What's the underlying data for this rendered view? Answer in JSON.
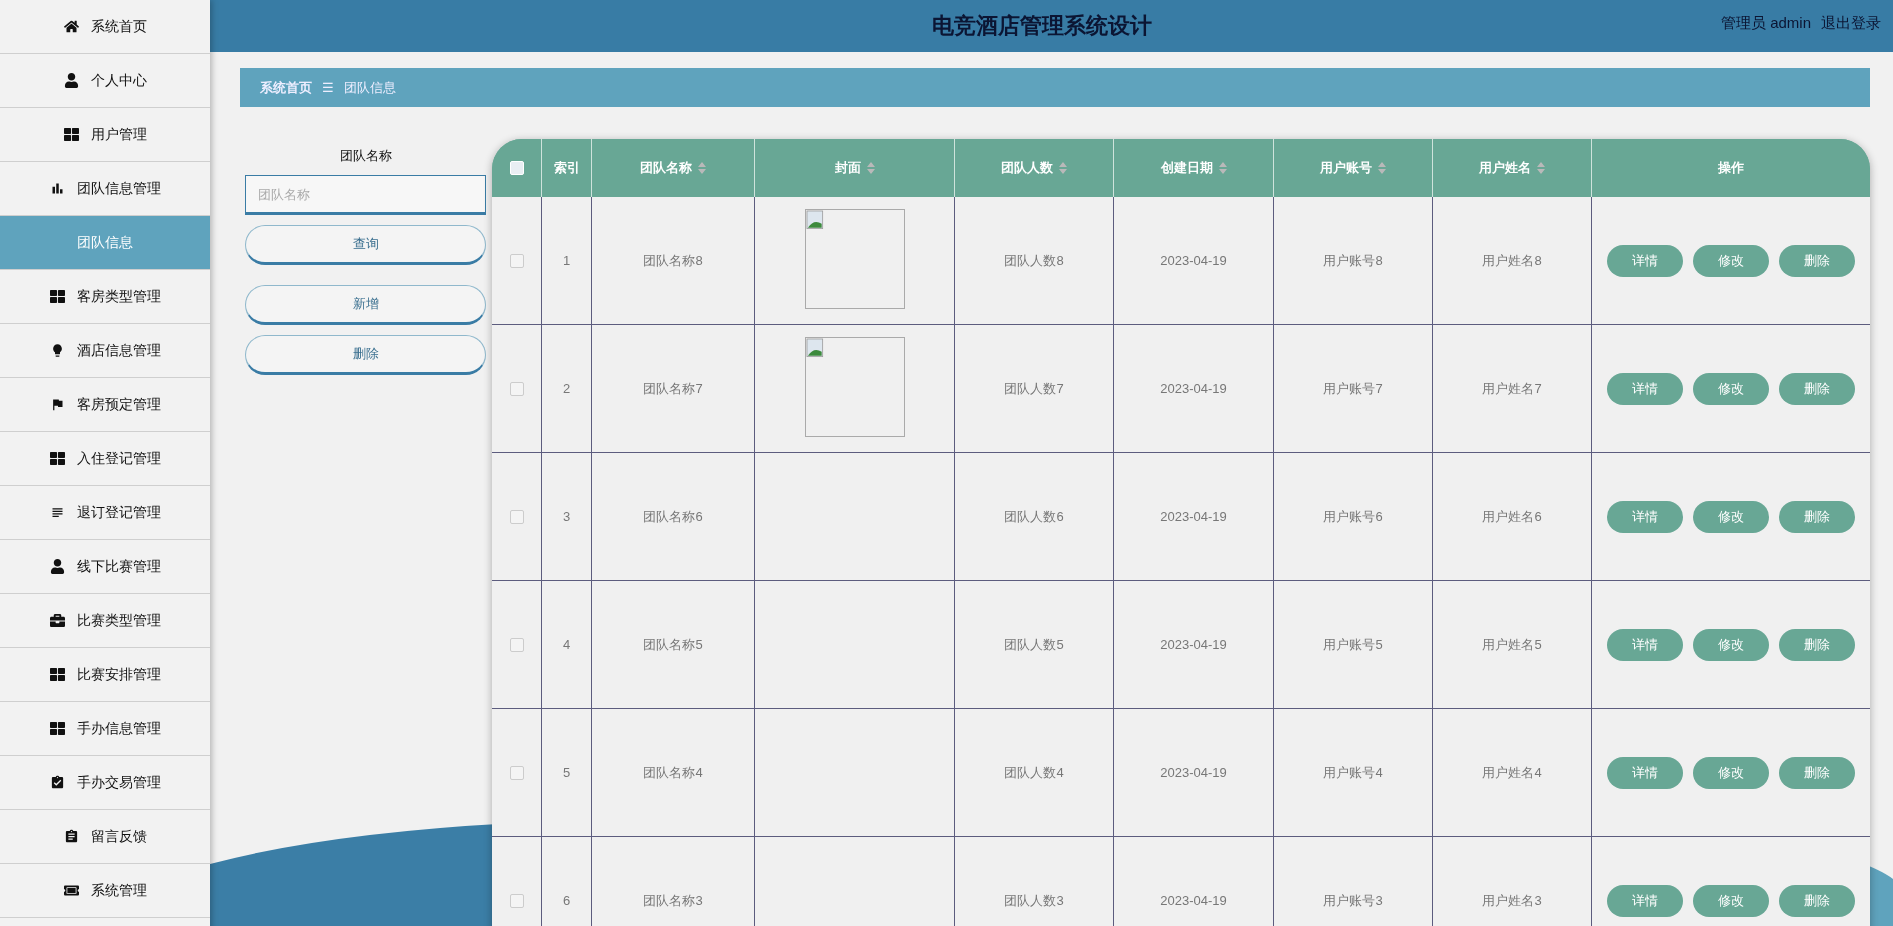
{
  "sidebar": {
    "items": [
      {
        "label": "系统首页",
        "selected": false
      },
      {
        "label": "个人中心",
        "selected": false
      },
      {
        "label": "用户管理",
        "selected": false
      },
      {
        "label": "团队信息管理",
        "selected": false,
        "expanded": true,
        "children": [
          {
            "label": "团队信息",
            "selected": true
          }
        ]
      },
      {
        "label": "客房类型管理",
        "selected": false
      },
      {
        "label": "酒店信息管理",
        "selected": false
      },
      {
        "label": "客房预定管理",
        "selected": false
      },
      {
        "label": "入住登记管理",
        "selected": false
      },
      {
        "label": "退订登记管理",
        "selected": false
      },
      {
        "label": "线下比赛管理",
        "selected": false
      },
      {
        "label": "比赛类型管理",
        "selected": false
      },
      {
        "label": "比赛安排管理",
        "selected": false
      },
      {
        "label": "手办信息管理",
        "selected": false
      },
      {
        "label": "手办交易管理",
        "selected": false
      },
      {
        "label": "留言反馈",
        "selected": false
      },
      {
        "label": "系统管理",
        "selected": false
      }
    ]
  },
  "header": {
    "title": "电竞酒店管理系统设计",
    "user": "管理员 admin",
    "logout": "退出登录"
  },
  "breadcrumb": {
    "home": "系统首页",
    "separator": "☰",
    "current": "团队信息"
  },
  "search": {
    "label": "团队名称",
    "placeholder": "团队名称",
    "buttons": [
      "查询",
      "新增",
      "删除"
    ]
  },
  "table": {
    "select_all": {
      "checked": false
    },
    "columns": [
      {
        "label": "索引",
        "sortable": false
      },
      {
        "label": "团队名称",
        "sortable": true
      },
      {
        "label": "封面",
        "sortable": true
      },
      {
        "label": "团队人数",
        "sortable": true
      },
      {
        "label": "创建日期",
        "sortable": true
      },
      {
        "label": "用户账号",
        "sortable": true
      },
      {
        "label": "用户姓名",
        "sortable": true
      },
      {
        "label": "操作",
        "sortable": false
      }
    ],
    "rows": [
      {
        "checked": false,
        "index": "1",
        "name": "团队名称8",
        "cover": true,
        "members": "团队人数8",
        "date": "2023-04-19",
        "account": "用户账号8",
        "username": "用户姓名8",
        "actions": [
          "详情",
          "修改",
          "删除"
        ]
      },
      {
        "checked": false,
        "index": "2",
        "name": "团队名称7",
        "cover": true,
        "members": "团队人数7",
        "date": "2023-04-19",
        "account": "用户账号7",
        "username": "用户姓名7",
        "actions": [
          "详情",
          "修改",
          "删除"
        ]
      },
      {
        "checked": false,
        "index": "3",
        "name": "团队名称6",
        "cover": false,
        "members": "团队人数6",
        "date": "2023-04-19",
        "account": "用户账号6",
        "username": "用户姓名6",
        "actions": [
          "详情",
          "修改",
          "删除"
        ]
      },
      {
        "checked": false,
        "index": "4",
        "name": "团队名称5",
        "cover": false,
        "members": "团队人数5",
        "date": "2023-04-19",
        "account": "用户账号5",
        "username": "用户姓名5",
        "actions": [
          "详情",
          "修改",
          "删除"
        ]
      },
      {
        "checked": false,
        "index": "5",
        "name": "团队名称4",
        "cover": false,
        "members": "团队人数4",
        "date": "2023-04-19",
        "account": "用户账号4",
        "username": "用户姓名4",
        "actions": [
          "详情",
          "修改",
          "删除"
        ]
      },
      {
        "checked": false,
        "index": "6",
        "name": "团队名称3",
        "cover": false,
        "members": "团队人数3",
        "date": "2023-04-19",
        "account": "用户账号3",
        "username": "用户姓名3",
        "actions": [
          "详情",
          "修改",
          "删除"
        ]
      }
    ]
  }
}
